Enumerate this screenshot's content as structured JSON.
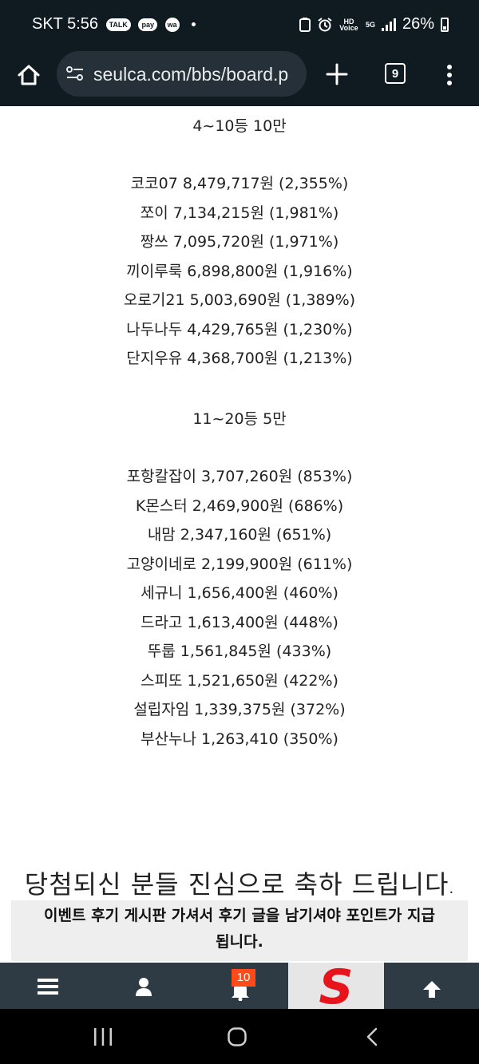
{
  "status_bar": {
    "carrier_time": "SKT 5:56",
    "apps": [
      "TALK",
      "pay",
      "wa"
    ],
    "indicators": [
      "HD Voice",
      "5G"
    ],
    "battery": "26%"
  },
  "browser": {
    "url": "seulca.com/bbs/board.p",
    "tab_count": "9"
  },
  "content": {
    "section1_heading": "4~10등 10만",
    "section1_rows": [
      "코코07  8,479,717원 (2,355%)",
      "쪼이  7,134,215원 (1,981%)",
      "짱쓰  7,095,720원 (1,971%)",
      "끼이루룩 6,898,800원 (1,916%)",
      "오로기21  5,003,690원 (1,389%)",
      "나두나두  4,429,765원 (1,230%)",
      "단지우유  4,368,700원 (1,213%)"
    ],
    "section2_heading": "11~20등 5만",
    "section2_rows": [
      "포항칼잡이 3,707,260원 (853%)",
      "K몬스터 2,469,900원 (686%)",
      "내맘 2,347,160원 (651%)",
      "고양이네로 2,199,900원 (611%)",
      "세규니 1,656,400원 (460%)",
      "드라고 1,613,400원 (448%)",
      "뚜룹 1,561,845원 (433%)",
      "스피또 1,521,650원 (422%)",
      "설립자임 1,339,375원 (372%)",
      "부산누나 1,263,410 (350%)"
    ],
    "congratulations": "당첨되신 분들 진심으로 축하 드립니다",
    "notice_line1": "이벤트 후기 게시판 가셔서 후기 글을 남기셔야 포인트가 지급",
    "notice_line2": "됩니다."
  },
  "bottom_nav": {
    "notification_count": "10",
    "logo_letter": "S"
  },
  "colors": {
    "top_bar": "#0f1a21",
    "address_pill": "#253038",
    "bottom_nav": "#2e3a44",
    "badge": "#ff4a1a",
    "logo_red": "#e8141c"
  }
}
